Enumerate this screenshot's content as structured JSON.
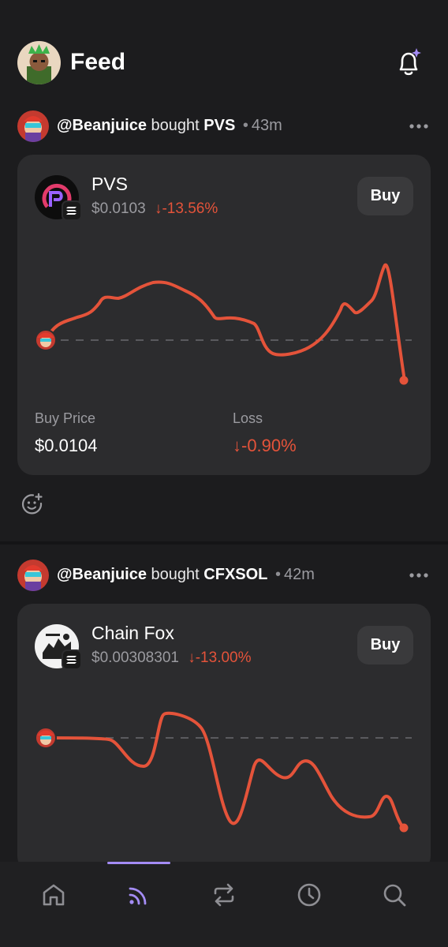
{
  "header": {
    "title": "Feed",
    "avatar_icon": "avatar-green-crown-icon",
    "notification_icon": "bell-sparkle-icon"
  },
  "posts": [
    {
      "handle": "@Beanjuice",
      "action": "bought",
      "symbol": "PVS",
      "dot": "•",
      "time": "43m",
      "token": {
        "name": "PVS",
        "price": "$0.0103",
        "change": "-13.56%",
        "change_arrow": "↓",
        "buy_label": "Buy"
      },
      "stats": {
        "buy_price_label": "Buy Price",
        "buy_price": "$0.0104",
        "result_label": "Loss",
        "result_arrow": "↓",
        "result_value": "-0.90%"
      }
    },
    {
      "handle": "@Beanjuice",
      "action": "bought",
      "symbol": "CFXSOL",
      "dot": "•",
      "time": "42m",
      "token": {
        "name": "Chain Fox",
        "price": "$0.00308301",
        "change": "-13.00%",
        "change_arrow": "↓",
        "buy_label": "Buy"
      }
    }
  ],
  "nav": {
    "items": [
      "home-icon",
      "feed-icon",
      "swap-icon",
      "history-icon",
      "search-icon"
    ],
    "active": "feed-icon"
  },
  "colors": {
    "background": "#1c1c1e",
    "card": "#2c2c2e",
    "loss_red": "#e4533a",
    "accent_purple": "#a48cf5"
  }
}
